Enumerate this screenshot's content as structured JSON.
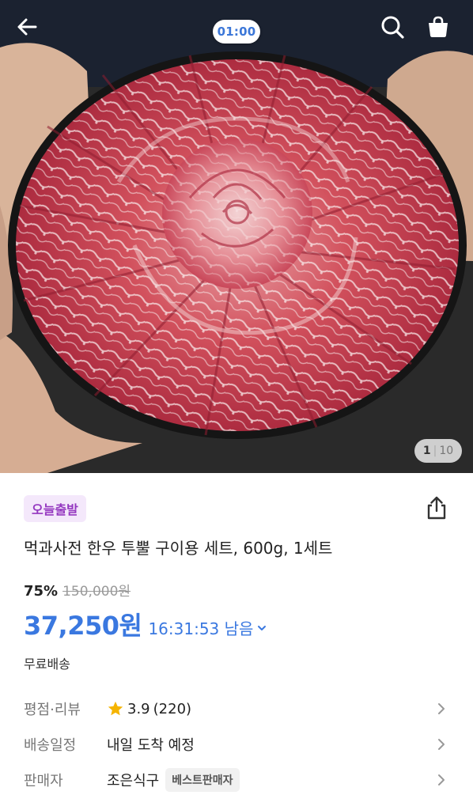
{
  "header": {
    "back_icon": "arrow-left-icon",
    "search_icon": "search-icon",
    "cart_icon": "shopping-bag-icon",
    "timer": "01:00"
  },
  "gallery": {
    "current": "1",
    "total": "10"
  },
  "product": {
    "badge": "오늘출발",
    "share_icon": "share-icon",
    "title": "먹과사전 한우 투뿔 구이용 세트, 600g, 1세트",
    "discount": "75%",
    "original_price": "150,000원",
    "price": "37,250원",
    "countdown": "16:31:53 남음",
    "shipping_note": "무료배송"
  },
  "details": {
    "rating_label": "평점·리뷰",
    "rating_value": "3.9",
    "rating_count": "(220)",
    "delivery_label": "배송일정",
    "delivery_value": "내일 도착 예정",
    "seller_label": "판매자",
    "seller_name": "조은식구",
    "seller_tag": "베스트판매자"
  },
  "colors": {
    "accent": "#3a78e0",
    "badge_bg": "#f4e8fb",
    "badge_text": "#9438c0",
    "star": "#f5b400"
  }
}
